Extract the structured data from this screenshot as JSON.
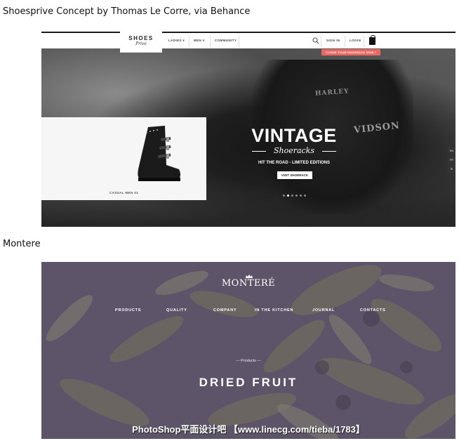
{
  "captions": {
    "first": "Shoesprive Concept by Thomas Le Corre, via Behance",
    "second": "Montere"
  },
  "shoesprive": {
    "logo": {
      "main": "SHOES",
      "sub": "Prive"
    },
    "nav": {
      "ladies": "LADIES",
      "men": "MEN",
      "community": "COMMUNITY"
    },
    "account": {
      "sign_in": "SIGN IN",
      "login": "LOGIN"
    },
    "cta": "CLEAR YOUR SHOERACK NOW !",
    "hero": {
      "headline": "VINTAGE",
      "script": "Shoeracks",
      "tagline": "HIT THE ROAD - LIMITED EDITIONS",
      "button": "VISIT SHOERACK",
      "jacket_text_1": "HARLEY",
      "jacket_text_2": "VIDSON"
    },
    "product_label": "CASUAL MEN 01",
    "carousel": {
      "count": 6,
      "active": 1
    },
    "side_tabs": [
      "EN",
      "FR",
      "☰"
    ]
  },
  "montere": {
    "logo": "MONTERÉ",
    "nav": [
      "PRODUCTS",
      "QUALITY",
      "COMPANY",
      "IN THE KITCHEN",
      "JOURNAL",
      "CONTACTS"
    ],
    "kicker": "— Products —",
    "title": "DRIED FRUIT",
    "watermark": "PhotoShop平面设计吧 【www.linecg.com/tieba/1783】"
  },
  "colors": {
    "cta": "#ea6a63",
    "montere_overlay": "#5f5462"
  }
}
